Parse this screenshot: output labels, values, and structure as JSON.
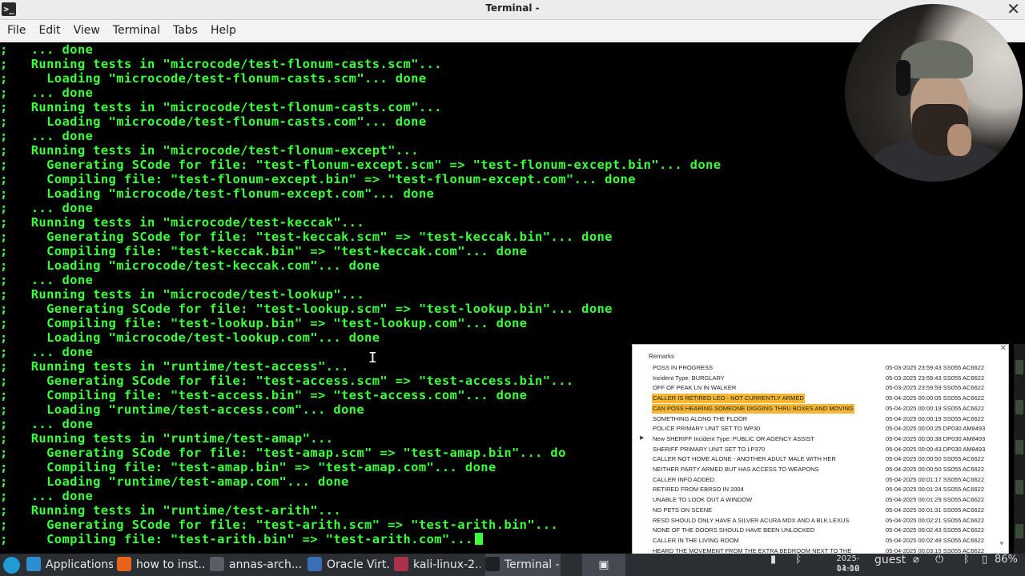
{
  "window": {
    "title": "Terminal -"
  },
  "menu": [
    "File",
    "Edit",
    "View",
    "Terminal",
    "Tabs",
    "Help"
  ],
  "terminal": {
    "lines": [
      ";   ... done",
      ";   Running tests in \"microcode/test-flonum-casts.scm\"...",
      ";     Loading \"microcode/test-flonum-casts.scm\"... done",
      ";   ... done",
      ";   Running tests in \"microcode/test-flonum-casts.com\"...",
      ";     Loading \"microcode/test-flonum-casts.com\"... done",
      ";   ... done",
      ";   Running tests in \"microcode/test-flonum-except\"...",
      ";     Generating SCode for file: \"test-flonum-except.scm\" => \"test-flonum-except.bin\"... done",
      ";     Compiling file: \"test-flonum-except.bin\" => \"test-flonum-except.com\"... done",
      ";     Loading \"microcode/test-flonum-except.com\"... done",
      ";   ... done",
      ";   Running tests in \"microcode/test-keccak\"...",
      ";     Generating SCode for file: \"test-keccak.scm\" => \"test-keccak.bin\"... done",
      ";     Compiling file: \"test-keccak.bin\" => \"test-keccak.com\"... done",
      ";     Loading \"microcode/test-keccak.com\"... done",
      ";   ... done",
      ";   Running tests in \"microcode/test-lookup\"...",
      ";     Generating SCode for file: \"test-lookup.scm\" => \"test-lookup.bin\"... done",
      ";     Compiling file: \"test-lookup.bin\" => \"test-lookup.com\"... done",
      ";     Loading \"microcode/test-lookup.com\"... done",
      ";   ... done",
      ";   Running tests in \"runtime/test-access\"...",
      ";     Generating SCode for file: \"test-access.scm\" => \"test-access.bin\"...",
      ";     Compiling file: \"test-access.bin\" => \"test-access.com\"... done",
      ";     Loading \"runtime/test-access.com\"... done",
      ";   ... done",
      ";   Running tests in \"runtime/test-amap\"...",
      ";     Generating SCode for file: \"test-amap.scm\" => \"test-amap.bin\"... do",
      ";     Compiling file: \"test-amap.bin\" => \"test-amap.com\"... done",
      ";     Loading \"runtime/test-amap.com\"... done",
      ";   ... done",
      ";   Running tests in \"runtime/test-arith\"...",
      ";     Generating SCode for file: \"test-arith.scm\" => \"test-arith.bin\"...",
      ";     Compiling file: \"test-arith.bin\" => \"test-arith.com\"..."
    ]
  },
  "remarks": {
    "header": "Remarks",
    "rows": [
      {
        "text": "POSS IN PROGRESS",
        "meta": "05-03-2025 23:59:43 SS055 AC6622"
      },
      {
        "text": "Incident Type: BURGLARY",
        "meta": "05-03-2025 23:59:43 SS055 AC6622"
      },
      {
        "text": "OFF OF PEAK LN IN WALKER",
        "meta": "05-03-2025 23:59:59 SS055 AC6622"
      },
      {
        "text": "CALLER IS RETIRED LEO - NOT CURRENTLY ARMED",
        "meta": "05-04-2025 00:00:05 SS055 AC6622",
        "highlight": true
      },
      {
        "text": "CAN POSS HEARING SOMEONE DIGGING THRU BOXES AND MOVING",
        "meta": "05-04-2025 00:00:19 SS055 AC6622",
        "highlight": true
      },
      {
        "text": "SOMETHING ALONG THE FLOOR",
        "meta": "05-04-2025 00:00:19 SS055 AC6622"
      },
      {
        "text": "POLICE PRIMARY UNIT SET TO WP30",
        "meta": "05-04-2025 00:00:25 DP030 AM8493"
      },
      {
        "text": "New SHERIFF Incident Type: PUBLIC OR AGENCY ASSIST",
        "meta": "05-04-2025 00:00:38 DP030 AM8493",
        "arrow": true
      },
      {
        "text": "SHERIFF PRIMARY UNIT SET TO LP370",
        "meta": "05-04-2025 00:00:43 DP030 AM8493"
      },
      {
        "text": "CALLER NOT HOME ALONE - ANOTHER ADULT MALE WITH HER",
        "meta": "05-04-2025 00:00:50 SS055 AC6622"
      },
      {
        "text": "NEITHER PARTY ARMED BUT HAS ACCESS TO WEAPONS",
        "meta": "05-04-2025 00:00:50 SS055 AC6622"
      },
      {
        "text": "CALLER INFO ADDED",
        "meta": "05-04-2025 00:01:17 SS055 AC6622"
      },
      {
        "text": "RETIRED FROM EBRSO IN 2004",
        "meta": "05-04-2025 00:01:24 SS055 AC6622"
      },
      {
        "text": "UNABLE TO LOOK OUT A WINDOW",
        "meta": "05-04-2025 00:01:29 SS055 AC6622"
      },
      {
        "text": "NO PETS ON SCENE",
        "meta": "05-04-2025 00:01:31 SS055 AC6622"
      },
      {
        "text": "RESD SHOULD ONLY HAVE A SILVER ACURA MDX AND A BLK LEXUS",
        "meta": "05-04-2025 00:02:21 SS055 AC6622"
      },
      {
        "text": "NONE OF THE DOORS SHOULD HAVE BEEN UNLOCKED",
        "meta": "05-04-2025 00:02:43 SS055 AC6622"
      },
      {
        "text": "CALLER IN THE LIVING ROOM",
        "meta": "05-04-2025 00:02:49 SS055 AC6622"
      },
      {
        "text": "HEARD THE MOVEMENT FROM THE EXTRA BEDROOM NEXT TO THE",
        "meta": "05-04-2025 00:03:15 SS055 AC6622"
      }
    ],
    "highlight_color": "#f7b731"
  },
  "taskbar": {
    "items": [
      {
        "label": "Applications",
        "icon_color": "#2d8fd0",
        "icon": "kali-dragon-icon"
      },
      {
        "label": "how to inst...",
        "icon_color": "#e8631c",
        "icon": "firefox-icon"
      },
      {
        "label": "annas-arch...",
        "icon_color": "#5a5e66",
        "icon": "window-icon"
      },
      {
        "label": "Oracle Virt...",
        "icon_color": "#3a6fb7",
        "icon": "virtualbox-icon"
      },
      {
        "label": "kali-linux-2...",
        "icon_color": "#a8324a",
        "icon": "vm-icon"
      },
      {
        "label": "Terminal -",
        "icon_color": "#1d1f22",
        "icon": "terminal-icon",
        "active": true
      }
    ],
    "user": "guest",
    "clock": {
      "date": "2025-11-10",
      "time": "04:08"
    },
    "battery": "86%"
  },
  "colors": {
    "terminal_fg": "#3cff3c",
    "terminal_bg": "#000000"
  }
}
